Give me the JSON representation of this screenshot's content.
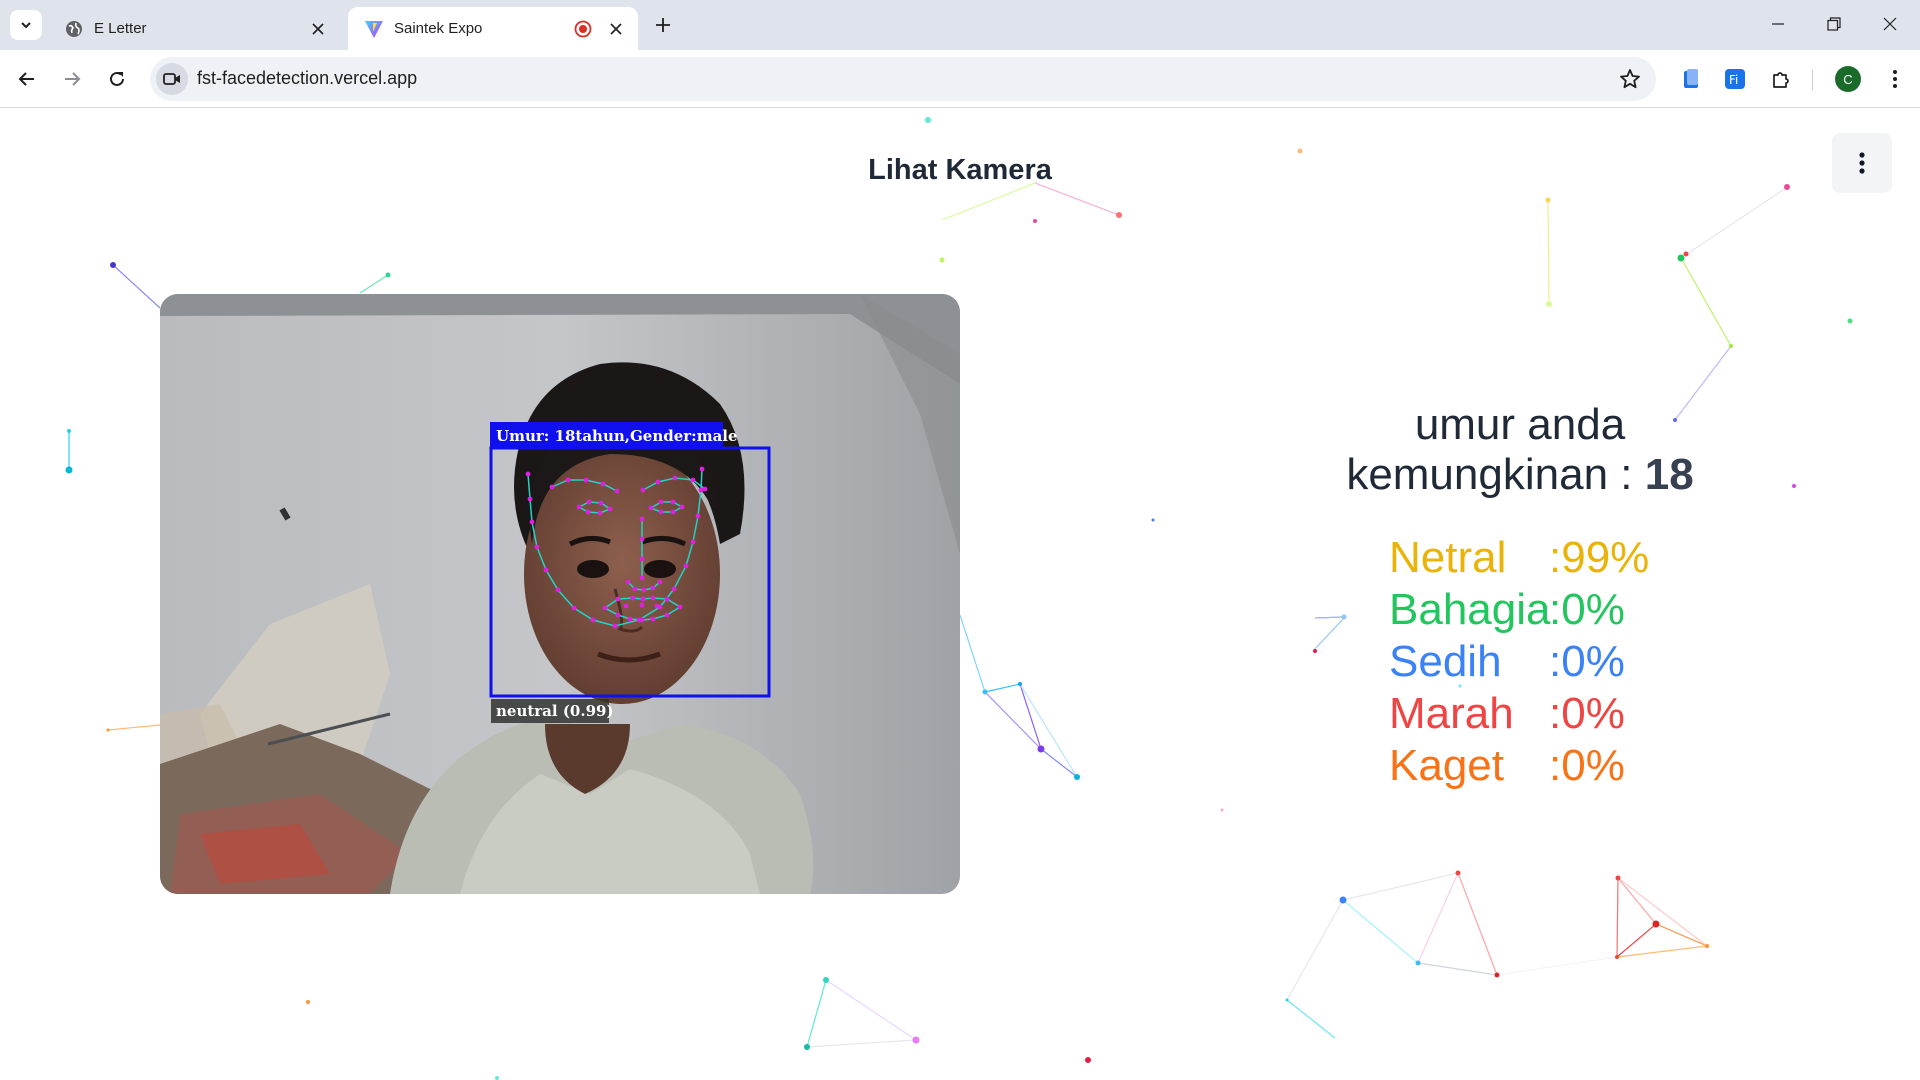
{
  "browser": {
    "tabs": [
      {
        "title": "E Letter",
        "active": false
      },
      {
        "title": "Saintek Expo",
        "active": true
      }
    ],
    "url": "fst-facedetection.vercel.app",
    "profile_initial": "C"
  },
  "page": {
    "title": "Lihat Kamera",
    "detection_box_label": "Umur: 18tahun,Gender:male",
    "expression_label": "neutral (0.99)",
    "age_prefix_line1": "umur anda",
    "age_prefix_line2": "kemungkinan :",
    "age_value": "18",
    "emotions": [
      {
        "name": "Netral",
        "value": ":99%",
        "color": "#eab308"
      },
      {
        "name": "Bahagia",
        "value": ":0%",
        "color": "#22c55e"
      },
      {
        "name": "Sedih",
        "value": ":0%",
        "color": "#3b82f6"
      },
      {
        "name": "Marah",
        "value": ":0%",
        "color": "#ef4444"
      },
      {
        "name": "Kaget",
        "value": ":0%",
        "color": "#f97316"
      }
    ]
  },
  "colors": {
    "detection_box": "#1010ee",
    "landmarks_line": "#22d3c5",
    "landmarks_point": "#e020e0"
  }
}
